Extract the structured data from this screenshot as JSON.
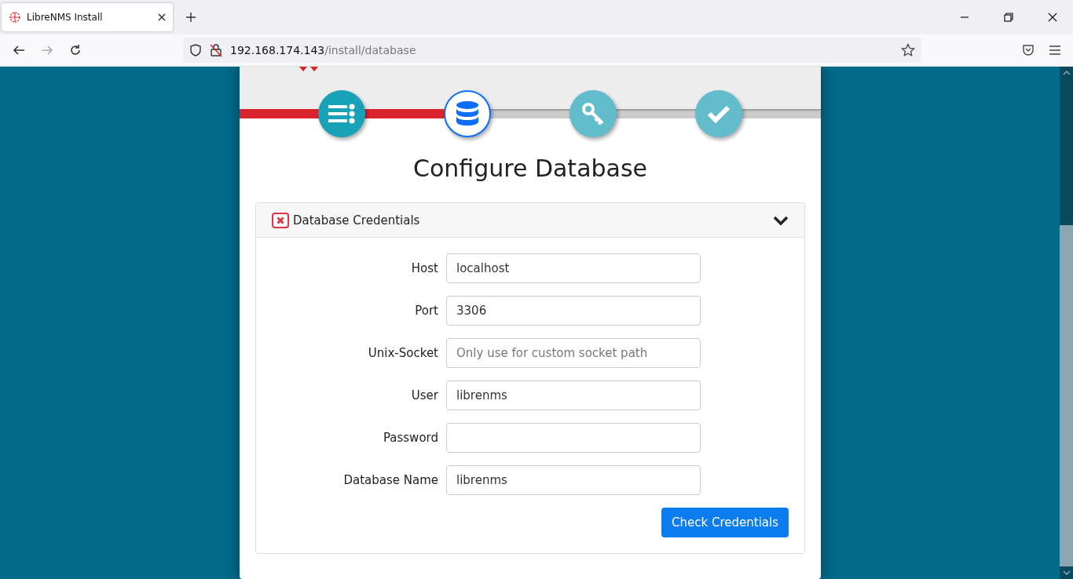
{
  "browser": {
    "tab_title": "LibreNMS Install",
    "url_host": "192.168.174.143",
    "url_path": "/install/database"
  },
  "progress": {
    "level": 0.39
  },
  "steps": [
    {
      "completed": true,
      "current": false
    },
    {
      "completed": false,
      "current": true
    },
    {
      "completed": false,
      "current": false
    },
    {
      "completed": false,
      "current": false
    }
  ],
  "heading": "Configure Database",
  "panel": {
    "title": "Database Credentials",
    "valid": false,
    "expanded": true
  },
  "fields": [
    {
      "label": "Host",
      "value": "localhost"
    },
    {
      "label": "Port",
      "value": "3306"
    },
    {
      "label": "Unix-Socket",
      "placeholder": "Only use for custom socket path"
    },
    {
      "label": "User",
      "value": "librenms"
    },
    {
      "label": "Password"
    },
    {
      "label": "Database Name",
      "value": "librenms"
    }
  ],
  "button": "Check Credentials"
}
